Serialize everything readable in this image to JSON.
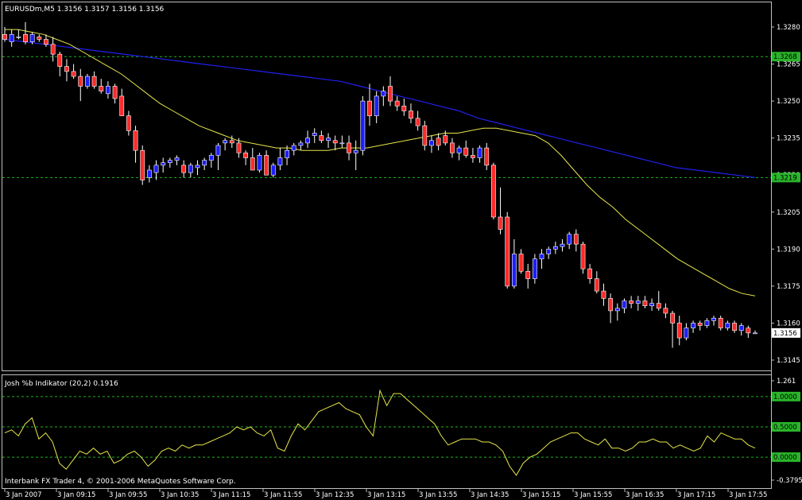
{
  "main_header": "EURUSDm,M5  1.3156 1.3157 1.3156 1.3156",
  "indicator_header": "Josh %b Indikator (20,2) 0.1916",
  "copyright": "Interbank FX Trader 4, © 2001-2006 MetaQuotes Software Corp.",
  "colors": {
    "background": "#000000",
    "frame": "#c0c0c0",
    "bull": "#1e1eff",
    "bear": "#ff2a2a",
    "wick": "#ffffff",
    "ma_fast": "#e6e64a",
    "ma_slow": "#2020ee",
    "level_line": "#1eb41e",
    "level_label_bg": "#2ab42a",
    "indicator_line": "#e6e64a"
  },
  "chart_data": [
    {
      "type": "candlestick",
      "symbol": "EURUSDm",
      "timeframe": "M5",
      "ylim": [
        1.314,
        1.3285
      ],
      "price_ticks": [
        "1.3280",
        "1.3265",
        "1.3250",
        "1.3235",
        "1.3220",
        "1.3205",
        "1.3190",
        "1.3175",
        "1.3160",
        "1.3145"
      ],
      "levels": [
        {
          "value": 1.3268,
          "label": "1.3268"
        },
        {
          "value": 1.3219,
          "label": "1.3219"
        }
      ],
      "current_price": {
        "value": 1.3156,
        "label": "1.3156"
      },
      "x_ticks": [
        "3 Jan 2007",
        "3 Jan 09:15",
        "3 Jan 09:55",
        "3 Jan 10:35",
        "3 Jan 11:15",
        "3 Jan 11:55",
        "3 Jan 12:35",
        "3 Jan 13:15",
        "3 Jan 13:55",
        "3 Jan 14:35",
        "3 Jan 15:15",
        "3 Jan 15:55",
        "3 Jan 16:35",
        "3 Jan 17:15",
        "3 Jan 17:55"
      ],
      "candles_ohlc": [
        [
          1.3277,
          1.328,
          1.3274,
          1.3275
        ],
        [
          1.3274,
          1.3279,
          1.3272,
          1.3277
        ],
        [
          1.3276,
          1.3279,
          1.3275,
          1.3276
        ],
        [
          1.3277,
          1.3282,
          1.3273,
          1.3274
        ],
        [
          1.3274,
          1.3278,
          1.3273,
          1.3277
        ],
        [
          1.3276,
          1.3277,
          1.3274,
          1.3275
        ],
        [
          1.3275,
          1.3277,
          1.3272,
          1.3273
        ],
        [
          1.3273,
          1.3276,
          1.3266,
          1.3269
        ],
        [
          1.3269,
          1.327,
          1.326,
          1.3264
        ],
        [
          1.3264,
          1.3267,
          1.3258,
          1.3262
        ],
        [
          1.3262,
          1.3265,
          1.3259,
          1.326
        ],
        [
          1.326,
          1.3263,
          1.325,
          1.3256
        ],
        [
          1.3256,
          1.3261,
          1.3255,
          1.326
        ],
        [
          1.326,
          1.3262,
          1.3255,
          1.3256
        ],
        [
          1.3256,
          1.3259,
          1.3253,
          1.3254
        ],
        [
          1.3253,
          1.3258,
          1.3251,
          1.3256
        ],
        [
          1.3256,
          1.3257,
          1.3249,
          1.3251
        ],
        [
          1.3252,
          1.3255,
          1.3246,
          1.3244
        ],
        [
          1.3244,
          1.3246,
          1.3236,
          1.3238
        ],
        [
          1.3238,
          1.324,
          1.3225,
          1.323
        ],
        [
          1.323,
          1.3232,
          1.3216,
          1.3218
        ],
        [
          1.3219,
          1.3224,
          1.3217,
          1.3222
        ],
        [
          1.3221,
          1.3226,
          1.3218,
          1.3224
        ],
        [
          1.3224,
          1.3227,
          1.3221,
          1.3225
        ],
        [
          1.3225,
          1.3227,
          1.3223,
          1.3226
        ],
        [
          1.3226,
          1.3228,
          1.3224,
          1.3227
        ],
        [
          1.3224,
          1.3226,
          1.3219,
          1.3221
        ],
        [
          1.3221,
          1.3225,
          1.3219,
          1.3224
        ],
        [
          1.3223,
          1.3226,
          1.322,
          1.3224
        ],
        [
          1.3224,
          1.3227,
          1.3222,
          1.3226
        ],
        [
          1.3226,
          1.3229,
          1.3223,
          1.3228
        ],
        [
          1.3228,
          1.3233,
          1.3222,
          1.3232
        ],
        [
          1.3233,
          1.3235,
          1.323,
          1.3234
        ],
        [
          1.3234,
          1.3236,
          1.3231,
          1.3233
        ],
        [
          1.3233,
          1.3235,
          1.3227,
          1.3229
        ],
        [
          1.3229,
          1.323,
          1.3224,
          1.3227
        ],
        [
          1.3227,
          1.3231,
          1.3222,
          1.3222
        ],
        [
          1.3222,
          1.3229,
          1.3221,
          1.3228
        ],
        [
          1.3228,
          1.323,
          1.322,
          1.322
        ],
        [
          1.322,
          1.3225,
          1.3219,
          1.3224
        ],
        [
          1.3224,
          1.3231,
          1.3222,
          1.3227
        ],
        [
          1.3227,
          1.3232,
          1.3224,
          1.323
        ],
        [
          1.323,
          1.3233,
          1.3228,
          1.3232
        ],
        [
          1.3232,
          1.3234,
          1.323,
          1.3233
        ],
        [
          1.3233,
          1.3238,
          1.3231,
          1.3235
        ],
        [
          1.3236,
          1.3239,
          1.3233,
          1.3237
        ],
        [
          1.3236,
          1.3238,
          1.3233,
          1.3234
        ],
        [
          1.3234,
          1.3237,
          1.3231,
          1.3235
        ],
        [
          1.3234,
          1.3236,
          1.323,
          1.3233
        ],
        [
          1.3233,
          1.3236,
          1.3231,
          1.3233
        ],
        [
          1.3233,
          1.3236,
          1.3226,
          1.3229
        ],
        [
          1.3229,
          1.3234,
          1.3222,
          1.323
        ],
        [
          1.323,
          1.3252,
          1.3228,
          1.325
        ],
        [
          1.325,
          1.3257,
          1.324,
          1.3244
        ],
        [
          1.3244,
          1.3254,
          1.3241,
          1.3252
        ],
        [
          1.3252,
          1.3256,
          1.3248,
          1.3254
        ],
        [
          1.3256,
          1.326,
          1.3248,
          1.325
        ],
        [
          1.325,
          1.3252,
          1.3246,
          1.3248
        ],
        [
          1.3248,
          1.3251,
          1.3244,
          1.3246
        ],
        [
          1.3246,
          1.3249,
          1.3241,
          1.3243
        ],
        [
          1.3243,
          1.3246,
          1.3238,
          1.324
        ],
        [
          1.324,
          1.3242,
          1.323,
          1.3232
        ],
        [
          1.3232,
          1.3236,
          1.3229,
          1.3234
        ],
        [
          1.3235,
          1.3237,
          1.323,
          1.3232
        ],
        [
          1.3236,
          1.3238,
          1.3232,
          1.3233
        ],
        [
          1.3233,
          1.3235,
          1.3227,
          1.3229
        ],
        [
          1.3229,
          1.3232,
          1.3226,
          1.3231
        ],
        [
          1.3231,
          1.3234,
          1.3227,
          1.3228
        ],
        [
          1.3228,
          1.3231,
          1.3225,
          1.3227
        ],
        [
          1.3227,
          1.3232,
          1.3225,
          1.3231
        ],
        [
          1.3231,
          1.3233,
          1.3222,
          1.3224
        ],
        [
          1.3224,
          1.3225,
          1.3202,
          1.3203
        ],
        [
          1.3203,
          1.3215,
          1.3196,
          1.3198
        ],
        [
          1.3203,
          1.3205,
          1.3174,
          1.3175
        ],
        [
          1.3175,
          1.3194,
          1.3174,
          1.3188
        ],
        [
          1.3188,
          1.319,
          1.318,
          1.3181
        ],
        [
          1.3181,
          1.3184,
          1.3174,
          1.3178
        ],
        [
          1.3178,
          1.3188,
          1.3176,
          1.3186
        ],
        [
          1.3186,
          1.319,
          1.3182,
          1.3188
        ],
        [
          1.3188,
          1.3191,
          1.3186,
          1.319
        ],
        [
          1.319,
          1.3193,
          1.3188,
          1.3191
        ],
        [
          1.3191,
          1.3194,
          1.3189,
          1.3192
        ],
        [
          1.3192,
          1.3197,
          1.319,
          1.3196
        ],
        [
          1.3196,
          1.3198,
          1.3189,
          1.3192
        ],
        [
          1.3192,
          1.3193,
          1.318,
          1.3182
        ],
        [
          1.3182,
          1.3184,
          1.3176,
          1.3178
        ],
        [
          1.3178,
          1.3181,
          1.3172,
          1.3173
        ],
        [
          1.3173,
          1.3176,
          1.3167,
          1.317
        ],
        [
          1.317,
          1.3172,
          1.316,
          1.3165
        ],
        [
          1.3165,
          1.3168,
          1.3161,
          1.3166
        ],
        [
          1.3166,
          1.317,
          1.3164,
          1.3169
        ],
        [
          1.3169,
          1.3171,
          1.3166,
          1.3168
        ],
        [
          1.3168,
          1.3171,
          1.3165,
          1.3169
        ],
        [
          1.3169,
          1.3171,
          1.3166,
          1.3167
        ],
        [
          1.3167,
          1.317,
          1.3165,
          1.3168
        ],
        [
          1.3168,
          1.3173,
          1.3165,
          1.3166
        ],
        [
          1.3166,
          1.3168,
          1.3162,
          1.3164
        ],
        [
          1.3164,
          1.3165,
          1.315,
          1.316
        ],
        [
          1.316,
          1.3163,
          1.3151,
          1.3154
        ],
        [
          1.3154,
          1.316,
          1.3153,
          1.3158
        ],
        [
          1.3158,
          1.3161,
          1.3156,
          1.316
        ],
        [
          1.316,
          1.3161,
          1.3157,
          1.3159
        ],
        [
          1.3159,
          1.3162,
          1.3158,
          1.3161
        ],
        [
          1.3161,
          1.3163,
          1.3159,
          1.3162
        ],
        [
          1.3162,
          1.3163,
          1.3157,
          1.3158
        ],
        [
          1.3158,
          1.3161,
          1.3157,
          1.316
        ],
        [
          1.316,
          1.3161,
          1.3156,
          1.3157
        ],
        [
          1.3157,
          1.316,
          1.3155,
          1.3159
        ],
        [
          1.3158,
          1.3159,
          1.3154,
          1.3156
        ],
        [
          1.3156,
          1.3157,
          1.3156,
          1.3156
        ]
      ],
      "ma_fast_values": [
        1.3279,
        1.3279,
        1.3278,
        1.3277,
        1.3275,
        1.3273,
        1.327,
        1.3267,
        1.3264,
        1.3261,
        1.3257,
        1.3253,
        1.3249,
        1.3246,
        1.3243,
        1.324,
        1.3238,
        1.3236,
        1.3234,
        1.3233,
        1.3232,
        1.3231,
        1.3231,
        1.323,
        1.323,
        1.323,
        1.3231,
        1.3231,
        1.3231,
        1.3232,
        1.3233,
        1.3234,
        1.3235,
        1.3236,
        1.3237,
        1.3237,
        1.3238,
        1.3239,
        1.3239,
        1.3238,
        1.3237,
        1.3236,
        1.3233,
        1.3228,
        1.3222,
        1.3216,
        1.3211,
        1.3207,
        1.3202,
        1.3198,
        1.3194,
        1.319,
        1.3186,
        1.3183,
        1.318,
        1.3177,
        1.3174,
        1.3172,
        1.3171
      ],
      "ma_slow_values": [
        1.3275,
        1.3274,
        1.3273,
        1.3272,
        1.3271,
        1.327,
        1.3269,
        1.3268,
        1.3267,
        1.3266,
        1.3265,
        1.3264,
        1.3263,
        1.3262,
        1.3261,
        1.326,
        1.3259,
        1.3258,
        1.3256,
        1.3254,
        1.3252,
        1.325,
        1.3248,
        1.3246,
        1.3243,
        1.3241,
        1.3239,
        1.3237,
        1.3235,
        1.3233,
        1.3231,
        1.3229,
        1.3227,
        1.3225,
        1.3223,
        1.3222,
        1.3221,
        1.322,
        1.3219
      ]
    },
    {
      "type": "line",
      "series": [
        {
          "name": "Josh %b Indikator (20,2)",
          "last_value": 0.1916
        }
      ],
      "ylim": [
        -0.3795,
        1.261
      ],
      "y_ticks": [
        "1.261",
        "1.0000",
        "0.5000",
        "0.0000",
        "-0.3795"
      ],
      "levels": [
        1.0,
        0.5,
        0.0
      ],
      "values": [
        0.4,
        0.45,
        0.35,
        0.55,
        0.65,
        0.3,
        0.4,
        0.25,
        -0.1,
        -0.2,
        -0.05,
        0.1,
        0.05,
        0.15,
        0.05,
        0.1,
        -0.1,
        -0.05,
        0.05,
        0.1,
        0.0,
        -0.15,
        -0.05,
        0.1,
        0.15,
        0.1,
        0.2,
        0.15,
        0.2,
        0.2,
        0.25,
        0.3,
        0.35,
        0.4,
        0.5,
        0.45,
        0.5,
        0.4,
        0.35,
        0.45,
        0.15,
        0.1,
        0.35,
        0.55,
        0.45,
        0.6,
        0.75,
        0.8,
        0.85,
        0.9,
        0.8,
        0.75,
        0.7,
        0.5,
        0.35,
        1.1,
        0.85,
        1.05,
        1.05,
        0.95,
        0.85,
        0.75,
        0.65,
        0.55,
        0.35,
        0.2,
        0.25,
        0.3,
        0.3,
        0.3,
        0.25,
        0.25,
        0.2,
        0.1,
        -0.15,
        -0.3,
        -0.1,
        0.0,
        0.05,
        0.15,
        0.25,
        0.3,
        0.35,
        0.4,
        0.4,
        0.3,
        0.25,
        0.2,
        0.3,
        0.15,
        0.15,
        0.1,
        0.15,
        0.25,
        0.25,
        0.3,
        0.25,
        0.25,
        0.15,
        0.2,
        0.15,
        0.1,
        0.15,
        0.35,
        0.25,
        0.4,
        0.35,
        0.3,
        0.3,
        0.2,
        0.15
      ]
    }
  ]
}
